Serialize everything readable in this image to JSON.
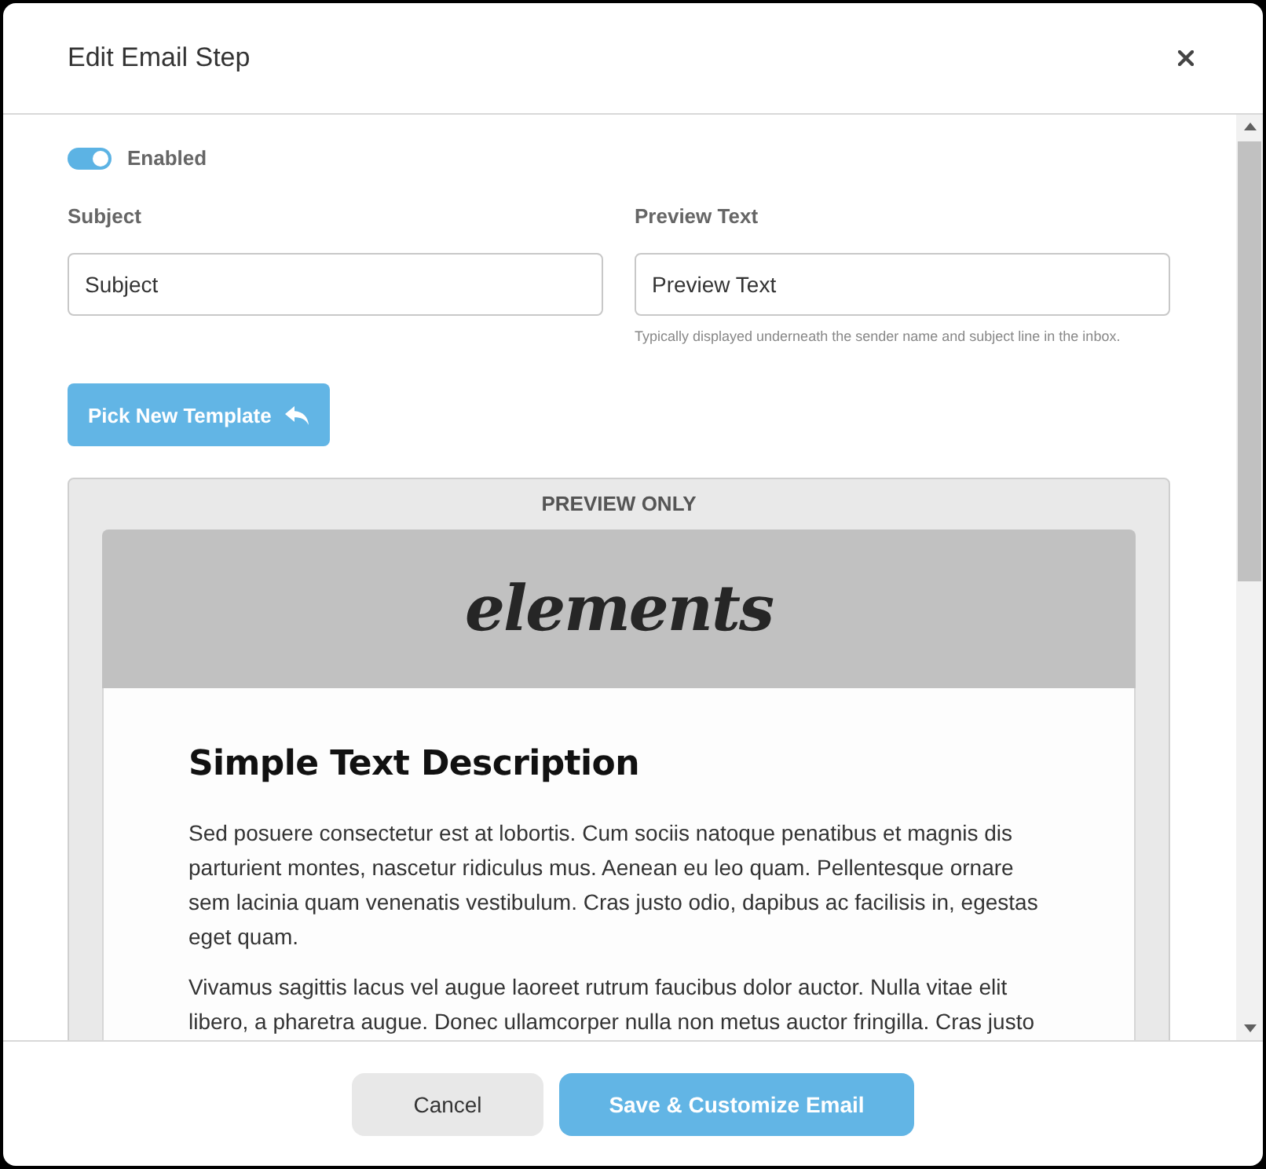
{
  "dialog": {
    "title": "Edit Email Step"
  },
  "enabled_toggle": {
    "label": "Enabled",
    "on": true
  },
  "fields": [
    {
      "label": "Subject",
      "value": "Subject"
    },
    {
      "label": "Preview Text",
      "value": "Preview Text",
      "hint": "Typically displayed underneath the sender name and subject line in the inbox."
    }
  ],
  "template_button": {
    "label": "Pick New Template"
  },
  "preview": {
    "caption": "PREVIEW ONLY",
    "logo": "elements",
    "heading": "Simple Text Description",
    "paragraphs": [
      "Sed posuere consectetur est at lobortis. Cum sociis natoque penatibus et magnis dis parturient montes, nascetur ridiculus mus. Aenean eu leo quam. Pellentesque ornare sem lacinia quam venenatis vestibulum. Cras justo odio, dapibus ac facilisis in, egestas eget quam.",
      "Vivamus sagittis lacus vel augue laoreet rutrum faucibus dolor auctor. Nulla vitae elit libero, a pharetra augue. Donec ullamcorper nulla non metus auctor fringilla. Cras justo"
    ]
  },
  "footer_buttons": [
    {
      "label": "Cancel",
      "kind": "secondary"
    },
    {
      "label": "Save & Customize Email",
      "kind": "primary"
    }
  ]
}
